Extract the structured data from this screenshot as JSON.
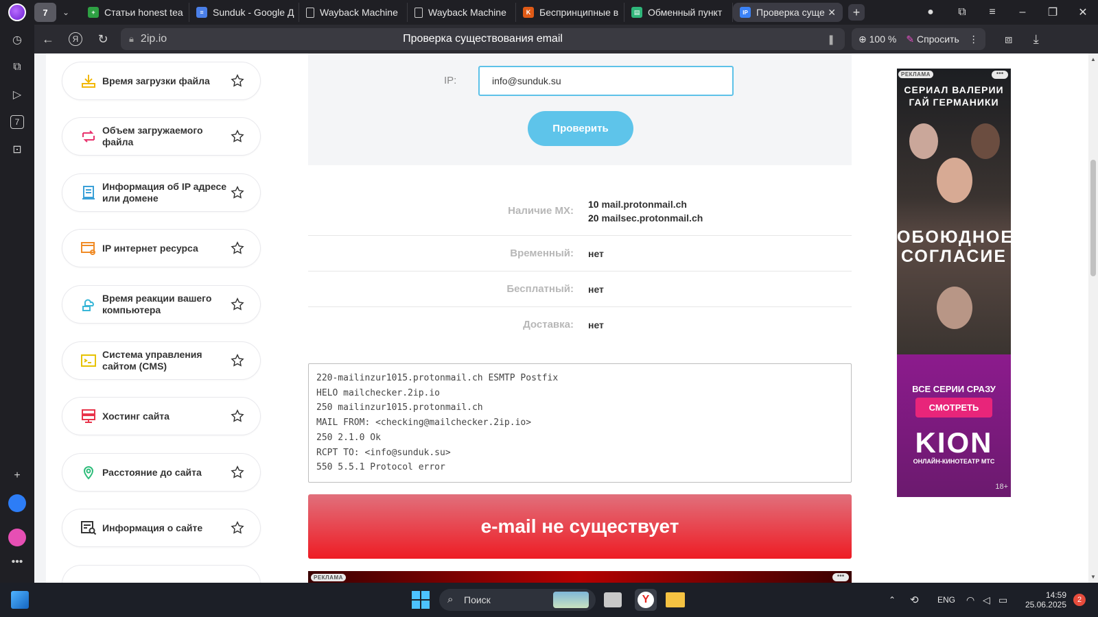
{
  "browser": {
    "tab_counter": "7",
    "tabs": [
      {
        "label": "Статьи honest tea",
        "color": "#2ea043",
        "glyph": "+"
      },
      {
        "label": "Sunduk - Google Д",
        "color": "#4a7fe8",
        "glyph": "≡"
      },
      {
        "label": "Wayback Machine",
        "color": "#cccccc",
        "glyph": ""
      },
      {
        "label": "Wayback Machine",
        "color": "#cccccc",
        "glyph": ""
      },
      {
        "label": "Беспринципные в",
        "color": "#e05a16",
        "glyph": "K"
      },
      {
        "label": "Обменный пункт",
        "color": "#2fb67a",
        "glyph": "▤"
      },
      {
        "label": "Проверка суще",
        "color": "#3b82f6",
        "glyph": "IP"
      }
    ],
    "url": "2ip.io",
    "page_title": "Проверка существования email",
    "zoom": "100 %",
    "ask_label": "Спросить"
  },
  "sidebar_tools": [
    {
      "label": "Время загрузки файла"
    },
    {
      "label": "Объем загружаемого файла"
    },
    {
      "label": "Информация об IP адресе или домене"
    },
    {
      "label": "IP интернет ресурса"
    },
    {
      "label": "Время реакции вашего компьютера"
    },
    {
      "label": "Система управления сайтом (CMS)"
    },
    {
      "label": "Хостинг сайта"
    },
    {
      "label": "Расстояние до сайта"
    },
    {
      "label": "Информация о сайте"
    }
  ],
  "form": {
    "ip_label": "IP:",
    "email_value": "info@sunduk.su",
    "check_button": "Проверить"
  },
  "results": {
    "mx_label": "Наличие MX:",
    "mx": [
      {
        "priority": "10",
        "host": "mail.protonmail.ch"
      },
      {
        "priority": "20",
        "host": "mailsec.protonmail.ch"
      }
    ],
    "temporary_label": "Временный:",
    "temporary_value": "нет",
    "free_label": "Бесплатный:",
    "free_value": "нет",
    "delivery_label": "Доставка:",
    "delivery_value": "нет"
  },
  "smtp_log": [
    "220-mailinzur1015.protonmail.ch ESMTP Postfix",
    "HELO mailchecker.2ip.io",
    "250 mailinzur1015.protonmail.ch",
    "MAIL FROM: <checking@mailchecker.2ip.io>",
    "250 2.1.0 Ok",
    "RCPT TO: <info@sunduk.su>",
    "550 5.5.1 Protocol error"
  ],
  "result_banner": "e-mail не существует",
  "ads": {
    "tag": "РЕКЛАМА",
    "series_line": "СЕРИАЛ ВАЛЕРИИ ГАЙ ГЕРМАНИКИ",
    "title": "ОБОЮДНОЕ СОГЛАСИЕ",
    "all_episodes": "ВСЕ СЕРИИ СРАЗУ",
    "watch": "СМОТРЕТЬ",
    "brand": "KION",
    "brand_sub": "ОНЛАЙН-КИНОТЕАТР МТС",
    "age": "18+"
  },
  "taskbar": {
    "search": "Поиск",
    "lang": "ENG",
    "time": "14:59",
    "date": "25.06.2025",
    "notifications": "2"
  },
  "colors": {
    "accent": "#5ec4ea",
    "error_banner": "#ee1c24"
  }
}
